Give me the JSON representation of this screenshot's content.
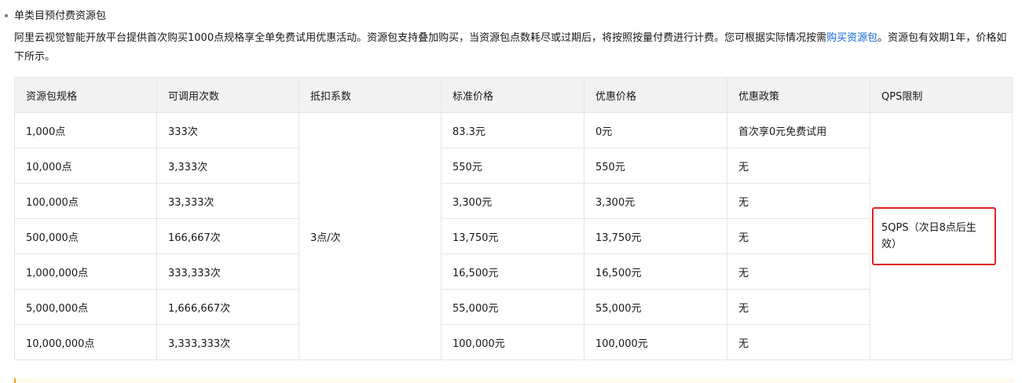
{
  "section": {
    "heading": "单类目预付费资源包",
    "paragraph_before_link": "阿里云视觉智能开放平台提供首次购买1000点规格享全单免费试用优惠活动。资源包支持叠加购买，当资源包点数耗尽或过期后，将按照按量付费进行计费。您可根据实际情况按需",
    "link_text": "购买资源包",
    "paragraph_after_link": "。资源包有效期1年，价格如下所示。"
  },
  "table": {
    "headers": [
      "资源包规格",
      "可调用次数",
      "抵扣系数",
      "标准价格",
      "优惠价格",
      "优惠政策",
      "QPS限制"
    ],
    "deduction": "3点/次",
    "qps": "5QPS（次日8点后生效）",
    "rows": [
      {
        "spec": "1,000点",
        "calls": "333次",
        "std": "83.3元",
        "promo": "0元",
        "policy": "首次享0元免费试用"
      },
      {
        "spec": "10,000点",
        "calls": "3,333次",
        "std": "550元",
        "promo": "550元",
        "policy": "无"
      },
      {
        "spec": "100,000点",
        "calls": "33,333次",
        "std": "3,300元",
        "promo": "3,300元",
        "policy": "无"
      },
      {
        "spec": "500,000点",
        "calls": "166,667次",
        "std": "13,750元",
        "promo": "13,750元",
        "policy": "无"
      },
      {
        "spec": "1,000,000点",
        "calls": "333,333次",
        "std": "16,500元",
        "promo": "16,500元",
        "policy": "无"
      },
      {
        "spec": "5,000,000点",
        "calls": "1,666,667次",
        "std": "55,000元",
        "promo": "55,000元",
        "policy": "无"
      },
      {
        "spec": "10,000,000点",
        "calls": "3,333,333次",
        "std": "100,000元",
        "promo": "100,000元",
        "policy": "无"
      }
    ]
  },
  "colors": {
    "link": "#1767e0",
    "highlight_border": "#e02020",
    "header_bg": "#f2f2f2"
  }
}
